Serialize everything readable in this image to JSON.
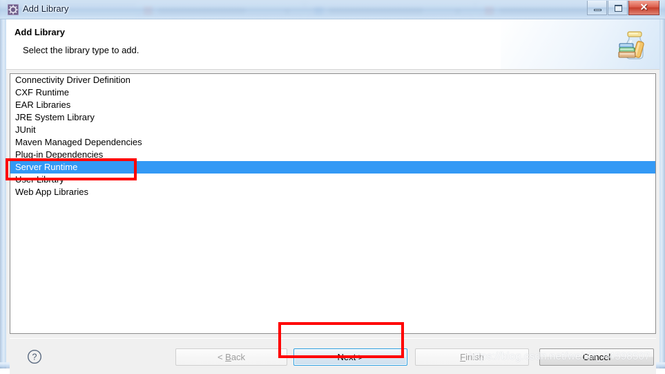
{
  "window": {
    "title": "Add Library",
    "icon": "eclipse-gear-icon",
    "controls": {
      "minimize": "minimize-icon",
      "maximize": "restore-icon",
      "close": "✕"
    }
  },
  "background": {
    "tabs": [
      {
        "title": "",
        "favicon_color": "#d05a55"
      },
      {
        "title": "",
        "favicon_color": "#5b8fd6"
      },
      {
        "title": "",
        "favicon_color": "#d05a55"
      }
    ]
  },
  "banner": {
    "title": "Add Library",
    "subtitle": "Select the library type to add.",
    "icon": "jar-library-icon"
  },
  "library_list": {
    "items": [
      {
        "label": "Connectivity Driver Definition",
        "selected": false
      },
      {
        "label": "CXF Runtime",
        "selected": false
      },
      {
        "label": "EAR Libraries",
        "selected": false
      },
      {
        "label": "JRE System Library",
        "selected": false
      },
      {
        "label": "JUnit",
        "selected": false
      },
      {
        "label": "Maven Managed Dependencies",
        "selected": false
      },
      {
        "label": "Plug-in Dependencies",
        "selected": false
      },
      {
        "label": "Server Runtime",
        "selected": true
      },
      {
        "label": "User Library",
        "selected": false
      },
      {
        "label": "Web App Libraries",
        "selected": false
      }
    ]
  },
  "buttons": {
    "help": "?",
    "back": {
      "label": "< Back",
      "mnemonic": "B",
      "disabled": true
    },
    "next": {
      "label": "Next >",
      "disabled": false,
      "default": true
    },
    "finish": {
      "label": "Finish",
      "mnemonic": "F",
      "disabled": true
    },
    "cancel": {
      "label": "Cancel",
      "disabled": false
    }
  },
  "annotations": {
    "highlight_selection": "Server Runtime",
    "highlight_button": "Next >",
    "color": "#ff0000"
  },
  "watermark": "https://blog.csdn.net/weixin_44598507",
  "colors": {
    "selection": "#3399f5",
    "annotation": "#ff0000",
    "dialog_bg": "#f0f0f0"
  }
}
